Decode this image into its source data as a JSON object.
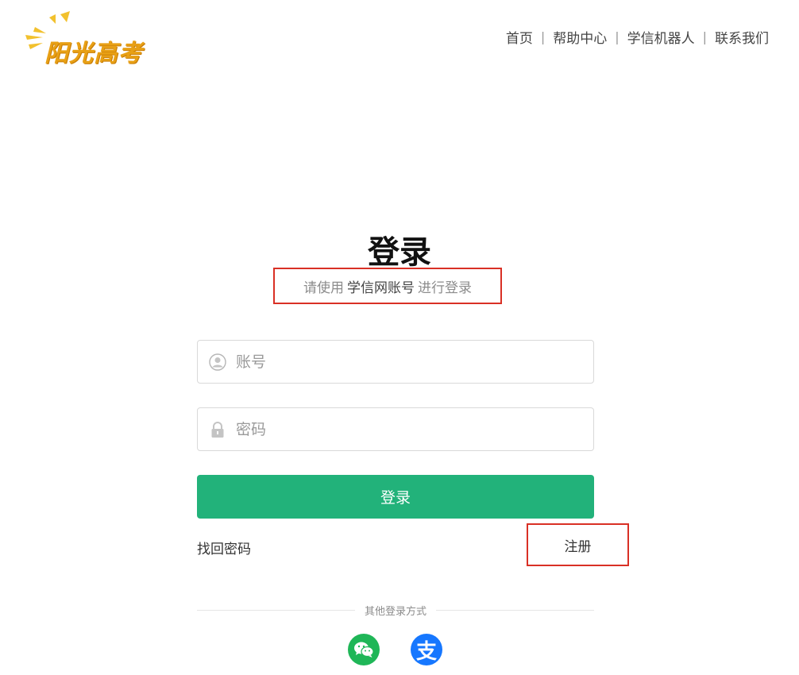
{
  "logo": {
    "text": "阳光高考"
  },
  "nav": {
    "home": "首页",
    "help": "帮助中心",
    "robot": "学信机器人",
    "contact": "联系我们",
    "separator": "|"
  },
  "login": {
    "title": "登录",
    "subtitle_prefix": "请使用",
    "subtitle_account": "学信网账号",
    "subtitle_suffix": "进行登录",
    "account_placeholder": "账号",
    "password_placeholder": "密码",
    "submit_label": "登录",
    "forgot_label": "找回密码",
    "register_label": "注册",
    "other_methods_label": "其他登录方式",
    "alipay_glyph": "支"
  },
  "colors": {
    "primary_button": "#22b27a",
    "highlight_border": "#d93025",
    "wechat": "#1fb657",
    "alipay": "#1677ff",
    "logo": "#e8a015"
  },
  "icons": {
    "account": "user-icon",
    "password": "lock-icon",
    "wechat": "wechat-icon",
    "alipay": "alipay-icon"
  }
}
